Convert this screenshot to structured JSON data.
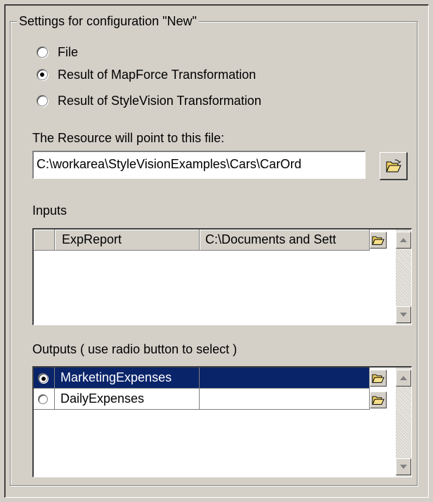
{
  "group_title": "Settings for configuration \"New\"",
  "source_options": [
    {
      "label": "File",
      "checked": false
    },
    {
      "label": "Result of MapForce Transformation",
      "checked": true
    },
    {
      "label": "Result of StyleVision Transformation",
      "checked": false
    }
  ],
  "file_label": "The Resource will point to this file:",
  "file_path": "C:\\workarea\\StyleVisionExamples\\Cars\\CarOrd",
  "inputs": {
    "label": "Inputs",
    "rows": [
      {
        "name": "ExpReport",
        "path": "C:\\Documents and Sett"
      }
    ]
  },
  "outputs": {
    "label": "Outputs ( use radio button to select )",
    "rows": [
      {
        "name": "MarketingExpenses",
        "selected": true
      },
      {
        "name": "DailyExpenses",
        "selected": false
      }
    ]
  },
  "icons": {
    "folder": "folder-open-icon",
    "scroll_up": "arrow-up-icon",
    "scroll_down": "arrow-down-icon"
  },
  "colors": {
    "background": "#d4d0c8",
    "selection": "#0a246a",
    "folder_yellow": "#f4d35e"
  }
}
